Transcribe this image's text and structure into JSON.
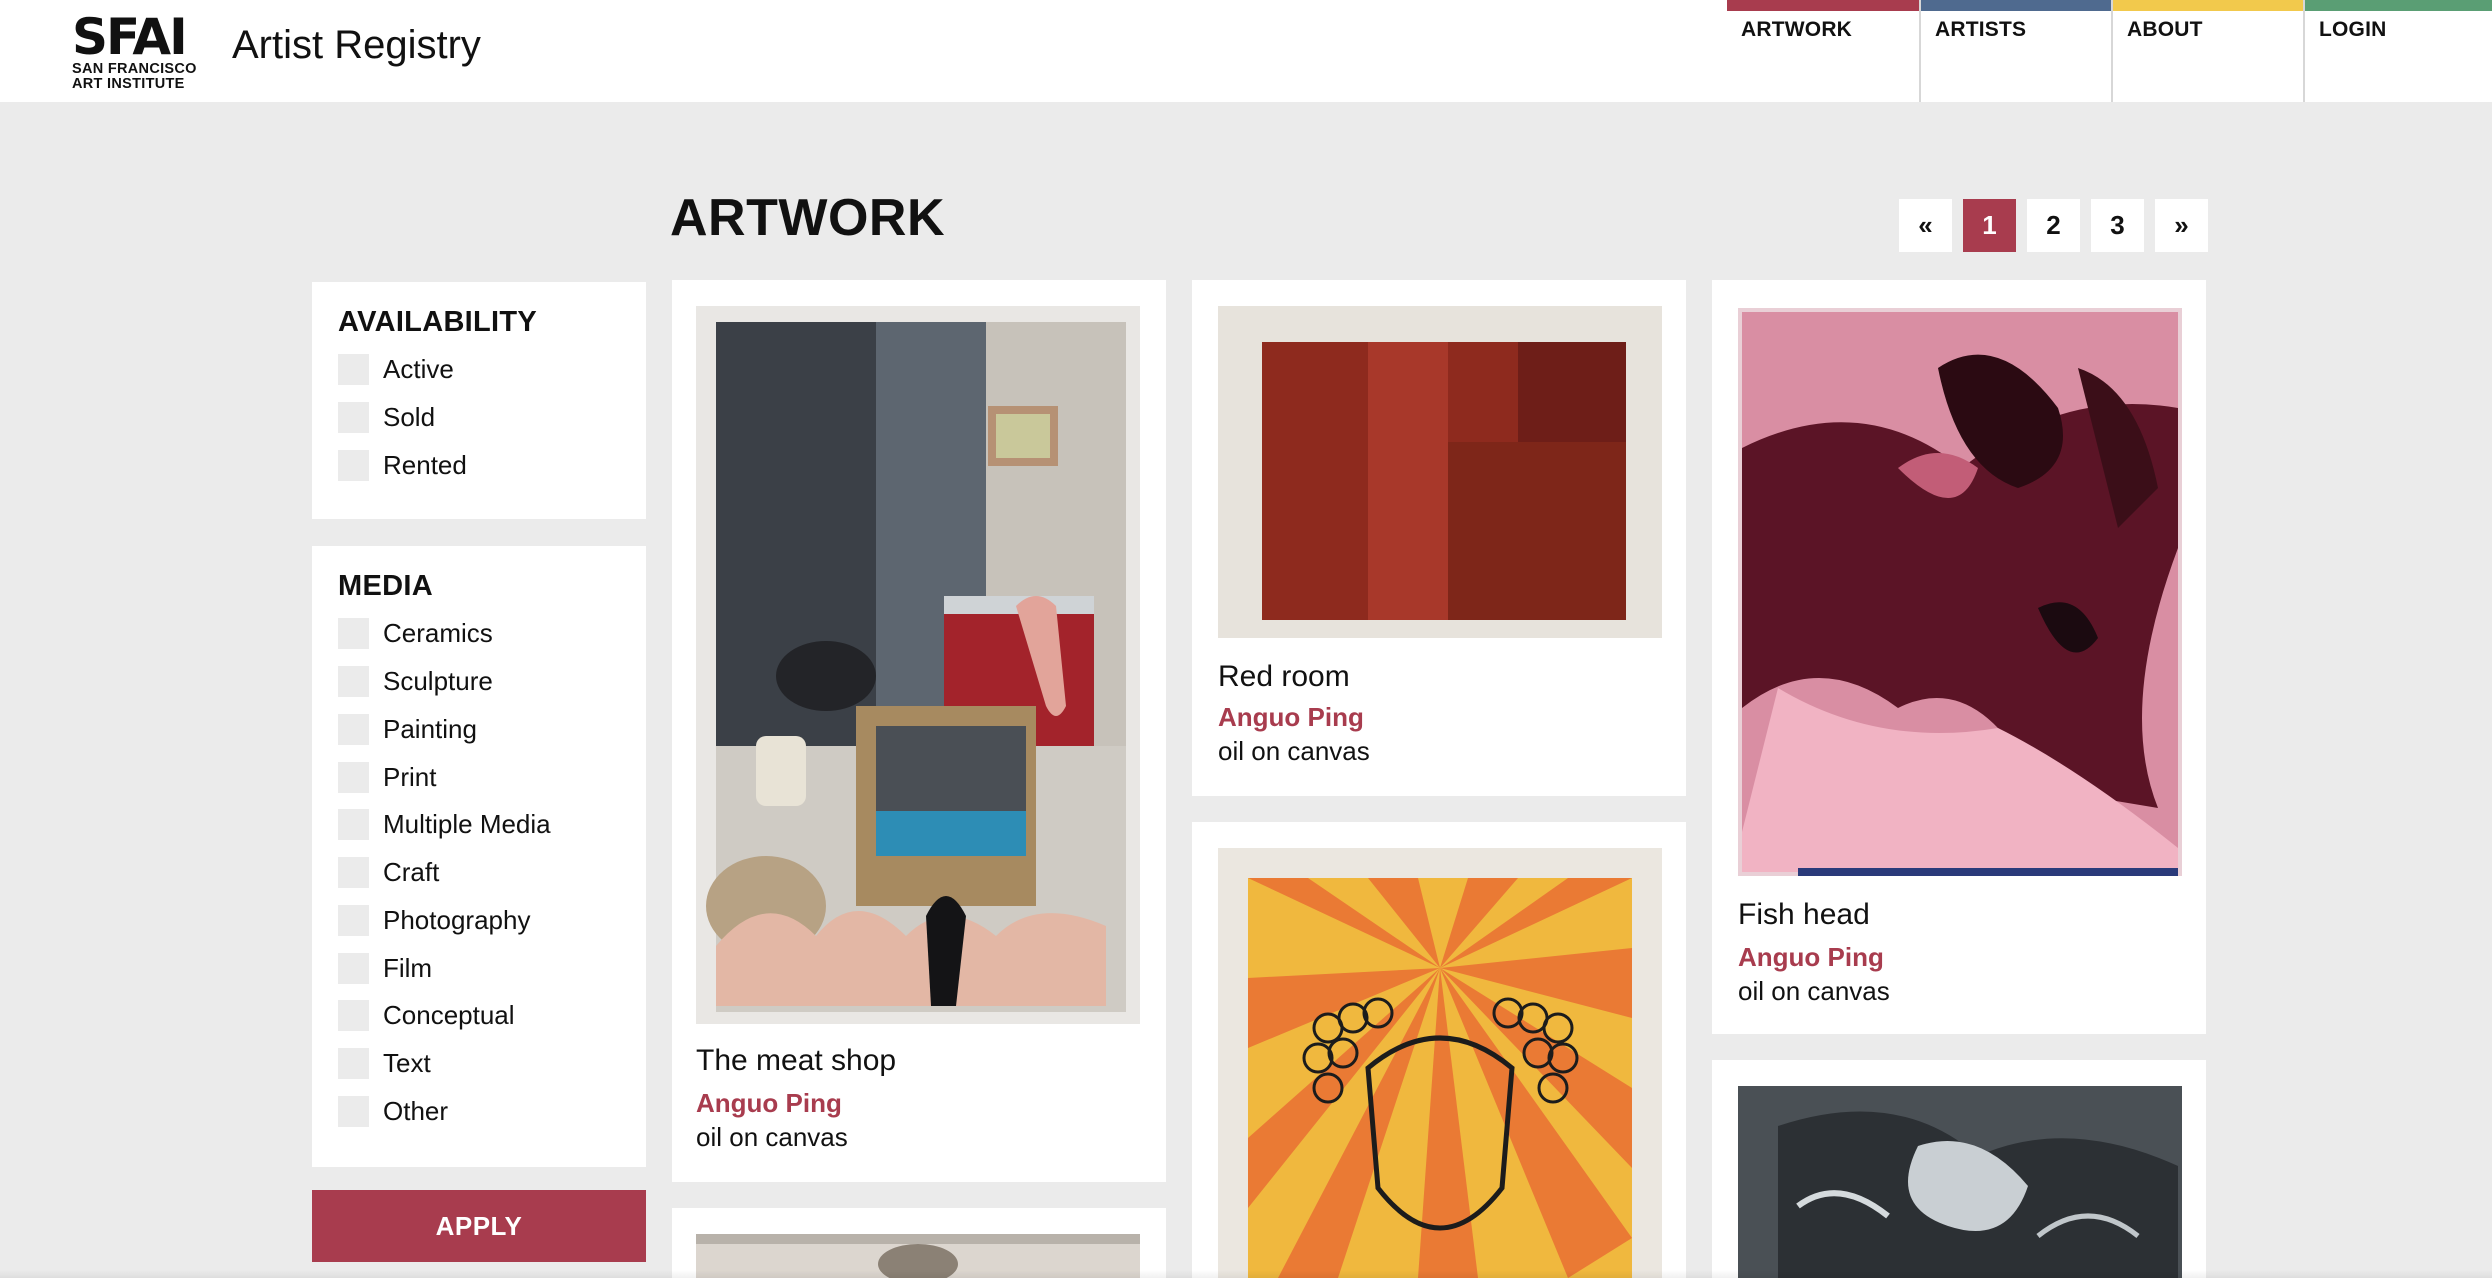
{
  "header": {
    "logo_mark": "SFAI",
    "logo_line1": "SAN FRANCISCO",
    "logo_line2": "ART INSTITUTE",
    "site_title": "Artist Registry"
  },
  "nav": [
    {
      "label": "ARTWORK",
      "color": "#a83c4e"
    },
    {
      "label": "ARTISTS",
      "color": "#4f6a8f"
    },
    {
      "label": "ABOUT",
      "color": "#f2c94c"
    },
    {
      "label": "LOGIN",
      "color": "#5a9e74"
    }
  ],
  "page_title": "ARTWORK",
  "pagination": {
    "prev": "«",
    "pages": [
      "1",
      "2",
      "3"
    ],
    "current": "1",
    "next": "»"
  },
  "filters": {
    "availability": {
      "title": "AVAILABILITY",
      "options": [
        "Active",
        "Sold",
        "Rented"
      ]
    },
    "media": {
      "title": "MEDIA",
      "options": [
        "Ceramics",
        "Sculpture",
        "Painting",
        "Print",
        "Multiple Media",
        "Craft",
        "Photography",
        "Film",
        "Conceptual",
        "Text",
        "Other"
      ]
    },
    "apply_label": "APPLY"
  },
  "artworks": [
    {
      "title": "The meat shop",
      "artist": "Anguo Ping",
      "media": "oil on canvas"
    },
    {
      "title": "Red room",
      "artist": "Anguo Ping",
      "media": "oil on canvas"
    },
    {
      "title": "Fish head",
      "artist": "Anguo Ping",
      "media": "oil on canvas"
    }
  ],
  "colors": {
    "accent": "#a83c4e",
    "page_bg": "#ebebeb",
    "card_bg": "#ffffff"
  }
}
